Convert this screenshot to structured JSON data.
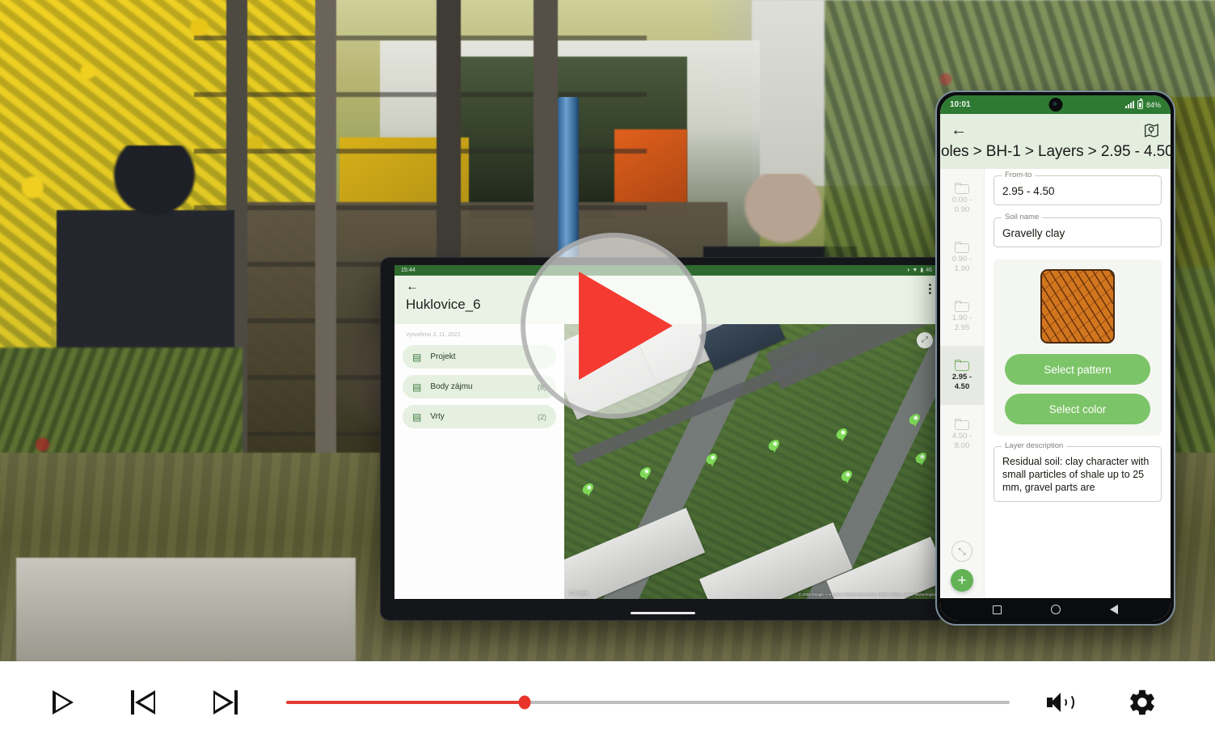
{
  "player": {
    "play_label": "Play",
    "prev_label": "Previous",
    "next_label": "Next",
    "volume_label": "Volume",
    "settings_label": "Settings",
    "progress_percent": 33,
    "big_play_label": "Play video"
  },
  "tablet": {
    "status": {
      "time": "15:44",
      "battery": "46"
    },
    "appbar": {
      "back_icon": "arrow-left-icon",
      "title": "Huklovice_6",
      "menu_icon": "kebab-menu-icon"
    },
    "created_text": "Vytvořeno 3. 11. 2022",
    "list": [
      {
        "icon": "document-icon",
        "label": "Projekt",
        "count": ""
      },
      {
        "icon": "list-icon",
        "label": "Body zájmu",
        "count": "(8)"
      },
      {
        "icon": "list-icon",
        "label": "Vrty",
        "count": "(2)"
      }
    ],
    "map": {
      "expand_icon": "expand-icon",
      "logo": "Google",
      "attribution": "© 2022 Google — Imagery ©2022 GeoContent, LNES / Airbus, Maxar Technologies",
      "pin_count": 8
    }
  },
  "phone": {
    "status": {
      "time": "10:01",
      "battery": "84%"
    },
    "appbar": {
      "back_icon": "arrow-left-icon",
      "map_icon": "map-pin-icon",
      "breadcrumb": "oles > BH-1 > Layers > 2.95 - 4.50"
    },
    "rail": {
      "items": [
        {
          "label": "0.00 -\n0.90",
          "active": false
        },
        {
          "label": "0.90 -\n1.90",
          "active": false
        },
        {
          "label": "1.90 -\n2.95",
          "active": false
        },
        {
          "label": "2.95 -\n4.50",
          "active": true
        },
        {
          "label": "4.50 -\n8.00",
          "active": false
        }
      ],
      "expand_icon": "expand-arrows-icon",
      "add_icon": "plus-icon"
    },
    "fields": {
      "from_to_label": "From-to",
      "from_to_value": "2.95 - 4.50",
      "soil_name_label": "Soil name",
      "soil_name_value": "Gravelly clay",
      "layer_description_label": "Layer description",
      "layer_description_value": "Residual soil: clay character with small particles of shale up to 25 mm, gravel parts are"
    },
    "buttons": {
      "select_pattern": "Select pattern",
      "select_color": "Select color"
    },
    "pattern_swatch": {
      "fill_color": "#d2761e",
      "line_color": "#5c2a0a",
      "border_color": "#4a2a10"
    },
    "navbar": {
      "recent_icon": "square-icon",
      "home_icon": "circle-icon",
      "back_icon": "triangle-back-icon"
    }
  },
  "colors": {
    "brand_green": "#2f7a33",
    "button_green": "#7cc468",
    "accent_red": "#e8332b",
    "appbar_bg": "#e4eedf"
  }
}
